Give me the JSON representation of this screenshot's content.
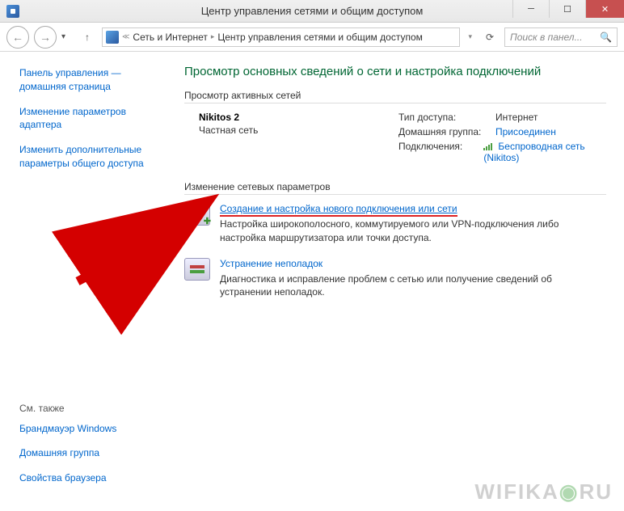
{
  "window": {
    "title": "Центр управления сетями и общим доступом"
  },
  "breadcrumb": {
    "part1": "Сеть и Интернет",
    "part2": "Центр управления сетями и общим доступом"
  },
  "search": {
    "placeholder": "Поиск в панел..."
  },
  "sidebar": {
    "link1": "Панель управления — домашняя страница",
    "link2": "Изменение параметров адаптера",
    "link3": "Изменить дополнительные параметры общего доступа",
    "see_also": "См. также",
    "bottom1": "Брандмауэр Windows",
    "bottom2": "Домашняя группа",
    "bottom3": "Свойства браузера"
  },
  "main": {
    "title": "Просмотр основных сведений о сети и настройка подключений",
    "active_nets": "Просмотр активных сетей",
    "net_name": "Nikitos  2",
    "net_type": "Частная сеть",
    "labels": {
      "access": "Тип доступа:",
      "homegroup": "Домашняя группа:",
      "connections": "Подключения:"
    },
    "values": {
      "access": "Интернет",
      "homegroup": "Присоединен",
      "connections": "Беспроводная сеть (Nikitos)"
    },
    "change_section": "Изменение сетевых параметров",
    "task1": {
      "title": "Создание и настройка нового подключения или сети",
      "desc": "Настройка широкополосного, коммутируемого или VPN-подключения либо настройка маршрутизатора или точки доступа."
    },
    "task2": {
      "title": "Устранение неполадок",
      "desc": "Диагностика и исправление проблем с сетью или получение сведений об устранении неполадок."
    }
  },
  "watermark": "WIFIKA RU"
}
